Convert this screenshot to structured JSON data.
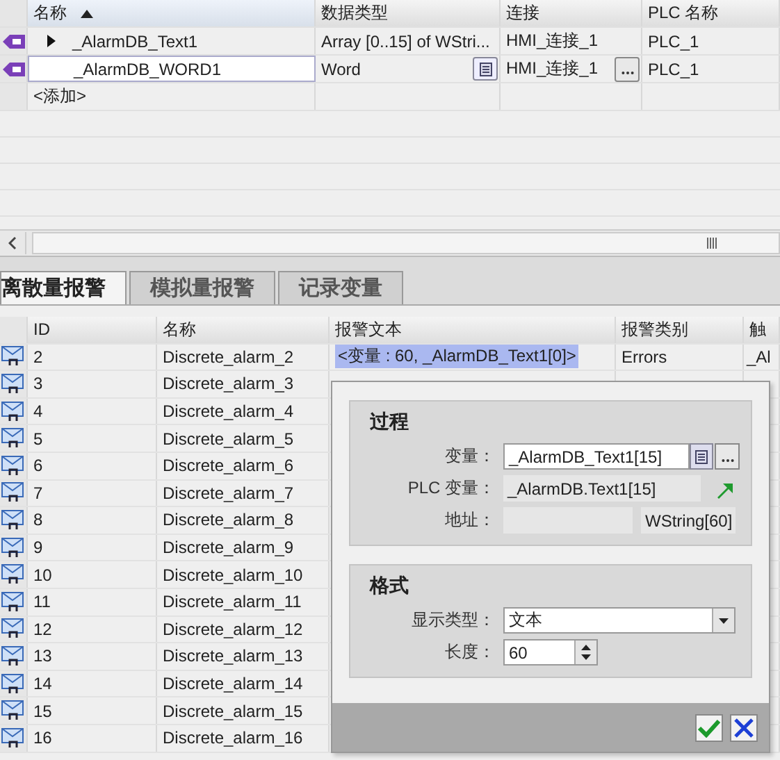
{
  "tag_table": {
    "columns": [
      {
        "label": "名称",
        "sorted": true
      },
      {
        "label": "数据类型",
        "sorted": false
      },
      {
        "label": "连接",
        "sorted": false
      },
      {
        "label": "PLC 名称",
        "sorted": false
      }
    ],
    "rows": [
      {
        "name": "_AlarmDB_Text1",
        "expandable": true,
        "editing": false,
        "data_type": "Array [0..15] of WStri...",
        "connection": "HMI_连接_1",
        "plc": "PLC_1"
      },
      {
        "name": "_AlarmDB_WORD1",
        "expandable": false,
        "editing": true,
        "data_type": "Word",
        "connection": "HMI_连接_1",
        "plc": "PLC_1"
      }
    ],
    "add_row": "<添加>"
  },
  "tabs": [
    {
      "label": "离散量报警",
      "selected": true
    },
    {
      "label": "模拟量报警",
      "selected": false
    },
    {
      "label": "记录变量",
      "selected": false
    }
  ],
  "alarm_table": {
    "columns": [
      "ID",
      "名称",
      "报警文本",
      "报警类别",
      "触"
    ],
    "rows": [
      {
        "id": "2",
        "name": "Discrete_alarm_2",
        "text": "<变量 : 60, _AlarmDB_Text1[0]>",
        "class": "Errors",
        "trigger": "_Al"
      },
      {
        "id": "3",
        "name": "Discrete_alarm_3"
      },
      {
        "id": "4",
        "name": "Discrete_alarm_4"
      },
      {
        "id": "5",
        "name": "Discrete_alarm_5"
      },
      {
        "id": "6",
        "name": "Discrete_alarm_6"
      },
      {
        "id": "7",
        "name": "Discrete_alarm_7"
      },
      {
        "id": "8",
        "name": "Discrete_alarm_8"
      },
      {
        "id": "9",
        "name": "Discrete_alarm_9"
      },
      {
        "id": "10",
        "name": "Discrete_alarm_10"
      },
      {
        "id": "11",
        "name": "Discrete_alarm_11"
      },
      {
        "id": "12",
        "name": "Discrete_alarm_12"
      },
      {
        "id": "13",
        "name": "Discrete_alarm_13"
      },
      {
        "id": "14",
        "name": "Discrete_alarm_14"
      },
      {
        "id": "15",
        "name": "Discrete_alarm_15"
      },
      {
        "id": "16",
        "name": "Discrete_alarm_16"
      }
    ]
  },
  "popup": {
    "process": {
      "title": "过程",
      "tag_label": "变量：",
      "tag_value": "_AlarmDB_Text1[15]",
      "plc_tag_label": "PLC 变量：",
      "plc_tag_value": "_AlarmDB.Text1[15]",
      "address_label": "地址：",
      "address_type": "WString[60]"
    },
    "format": {
      "title": "格式",
      "display_type_label": "显示类型：",
      "display_type_value": "文本",
      "length_label": "长度：",
      "length_value": "60"
    }
  }
}
